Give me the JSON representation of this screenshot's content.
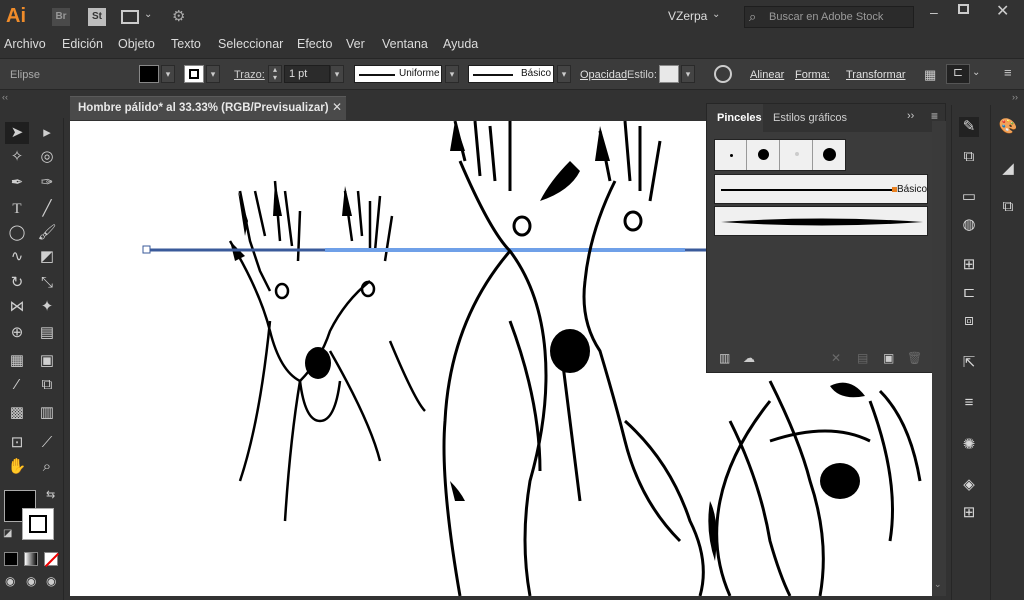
{
  "app": {
    "logo": "Ai",
    "bridge": "Br",
    "stock_icon": "St",
    "user": "VZerpa",
    "search_placeholder": "Buscar en Adobe Stock"
  },
  "menu": [
    "Archivo",
    "Edición",
    "Objeto",
    "Texto",
    "Seleccionar",
    "Efecto",
    "Ver",
    "Ventana",
    "Ayuda"
  ],
  "control": {
    "selection": "Elipse",
    "stroke_label": "Trazo:",
    "stroke_value": "1 pt",
    "profile": "Uniforme",
    "brush": "Básico",
    "opacity": "Opacidad",
    "style": "Estilo:",
    "align": "Alinear",
    "shape": "Forma:",
    "transform": "Transformar"
  },
  "document": {
    "tab_title": "Hombre pálido* al 33.33% (RGB/Previsualizar)"
  },
  "panel": {
    "tabs": [
      "Pinceles",
      "Estilos gráficos"
    ],
    "basic_brush": "Básico"
  },
  "colors": {
    "accent": "#4a90e2",
    "bg": "#323232",
    "panel": "#3b3b3b"
  }
}
